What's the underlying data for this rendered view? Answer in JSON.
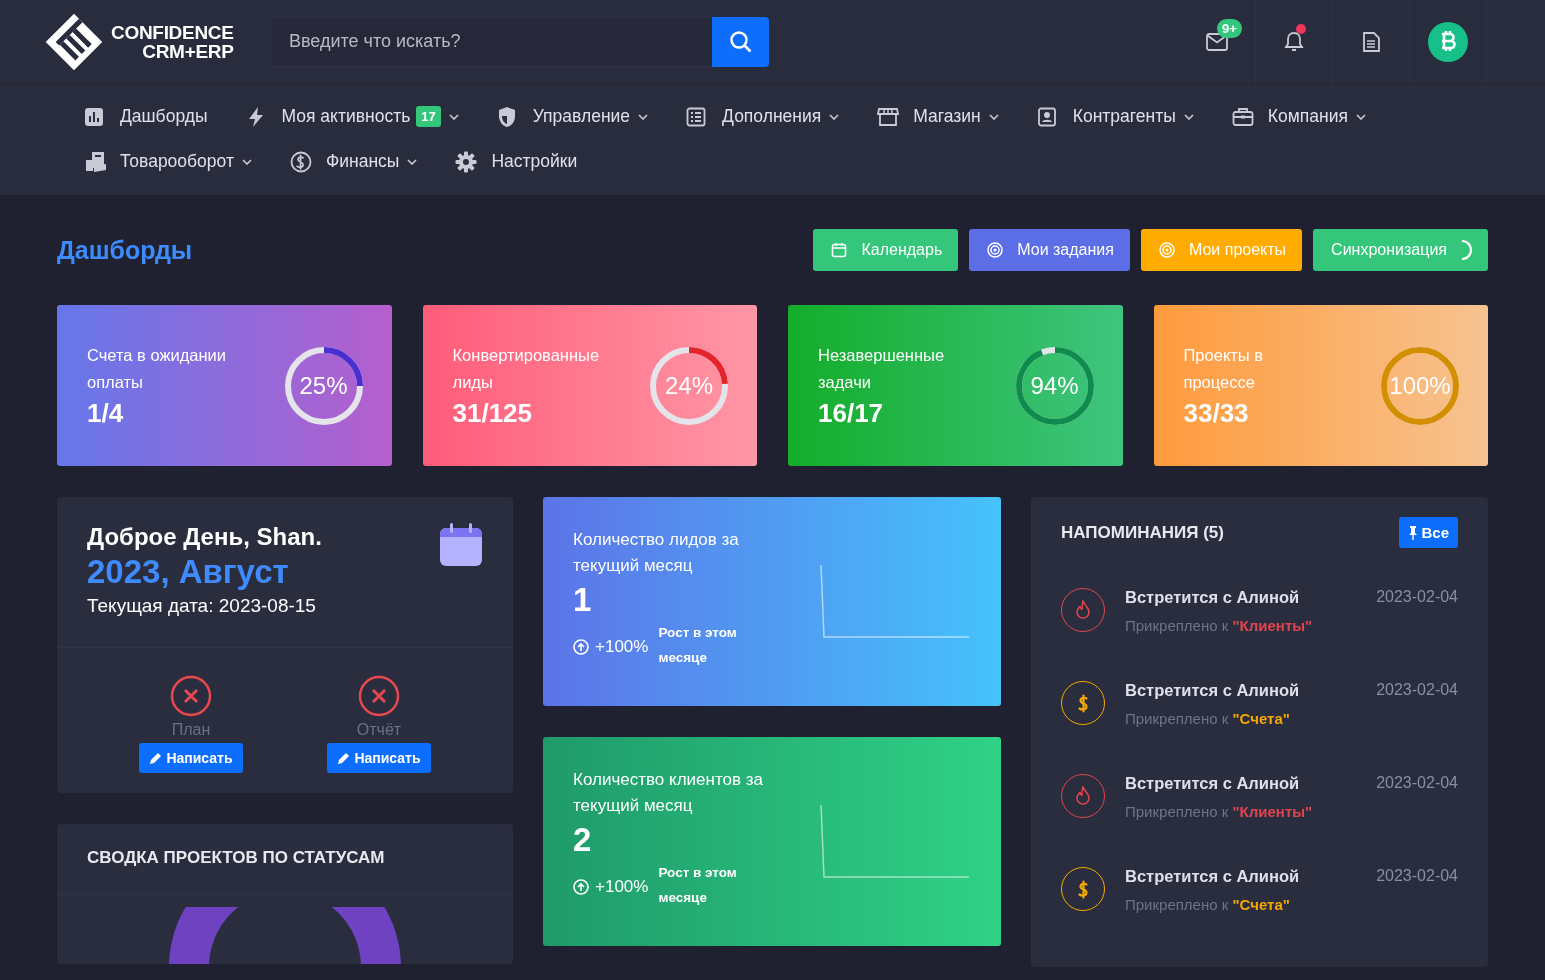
{
  "header": {
    "logo": [
      "CONFIDENCE",
      "CRM+ERP"
    ],
    "search": {
      "placeholder": "Введите что искать?"
    },
    "mail_badge": "9+",
    "bell_unread": true
  },
  "nav": [
    {
      "label": "Дашборды",
      "dropdown": false
    },
    {
      "label": "Моя активность",
      "badge": "17",
      "dropdown": true
    },
    {
      "label": "Управление",
      "dropdown": true
    },
    {
      "label": "Дополнения",
      "dropdown": true
    },
    {
      "label": "Магазин",
      "dropdown": true
    },
    {
      "label": "Контрагенты",
      "dropdown": true
    },
    {
      "label": "Компания",
      "dropdown": true
    },
    {
      "label": "Товарооборот",
      "dropdown": true
    },
    {
      "label": "Финансы",
      "dropdown": true
    },
    {
      "label": "Настройки",
      "dropdown": false
    }
  ],
  "page_title": "Дашборды",
  "actions": [
    {
      "label": "Календарь",
      "color": "#34c77b"
    },
    {
      "label": "Мои задания",
      "color": "#5c6ee6"
    },
    {
      "label": "Мои проекты",
      "color": "#ffab00"
    },
    {
      "label": "Синхронизация",
      "color": "#34c77b",
      "loading": true
    }
  ],
  "stats": [
    {
      "title": "Счета в ожидании оплаты",
      "value": "1/4",
      "percent": "25%",
      "level": 0.25,
      "color": "#4a2fd0"
    },
    {
      "title": "Конвертированные лиды",
      "value": "31/125",
      "percent": "24%",
      "level": 0.24,
      "color": "#e3242b"
    },
    {
      "title": "Незавершенные задачи",
      "value": "16/17",
      "percent": "94%",
      "level": 0.94,
      "color": "#0f8c4d"
    },
    {
      "title": "Проекты в процессе",
      "value": "33/33",
      "percent": "100%",
      "level": 1,
      "color": "#d48f00"
    }
  ],
  "greeting": {
    "title": "Доброе День, Shan.",
    "month": "2023, Август",
    "date_line": "Текущая дата: 2023-08-15",
    "reports": [
      {
        "label": "План",
        "done": false,
        "button": "Написать"
      },
      {
        "label": "Отчёт",
        "done": false,
        "button": "Написать"
      }
    ]
  },
  "counters": [
    {
      "title": "Количество лидов за текущий месяц",
      "value": "1",
      "growth": "+100%",
      "note": "Рост в этом месяце"
    },
    {
      "title": "Количество клиентов за текущий месяц",
      "value": "2",
      "growth": "+100%",
      "note": "Рост в этом месяце"
    }
  ],
  "summary": {
    "title": "СВОДКА ПРОЕКТОВ ПО СТАТУСАМ"
  },
  "reminders": {
    "title": "НАПОМИНАНИЯ (5)",
    "button": "Все",
    "items": [
      {
        "kind": "client",
        "title": "Встретится с Алиной",
        "date": "2023-02-04",
        "attached": "Прикреплено к **\"Клиенты\"**",
        "color": "#e0454f"
      },
      {
        "kind": "invoice",
        "title": "Встретится с Алиной",
        "date": "2023-02-04",
        "attached": "Прикреплено к **\"Счета\"**",
        "color": "#f5a800"
      },
      {
        "kind": "client",
        "title": "Встретится с Алиной",
        "date": "2023-02-04",
        "attached": "Прикреплено к **\"Клиенты\"**",
        "color": "#e0454f"
      },
      {
        "kind": "invoice",
        "title": "Встретится с Алиной",
        "date": "2023-02-04",
        "attached": "Прикреплено к **\"Счета\"**",
        "color": "#f5a800"
      }
    ]
  }
}
